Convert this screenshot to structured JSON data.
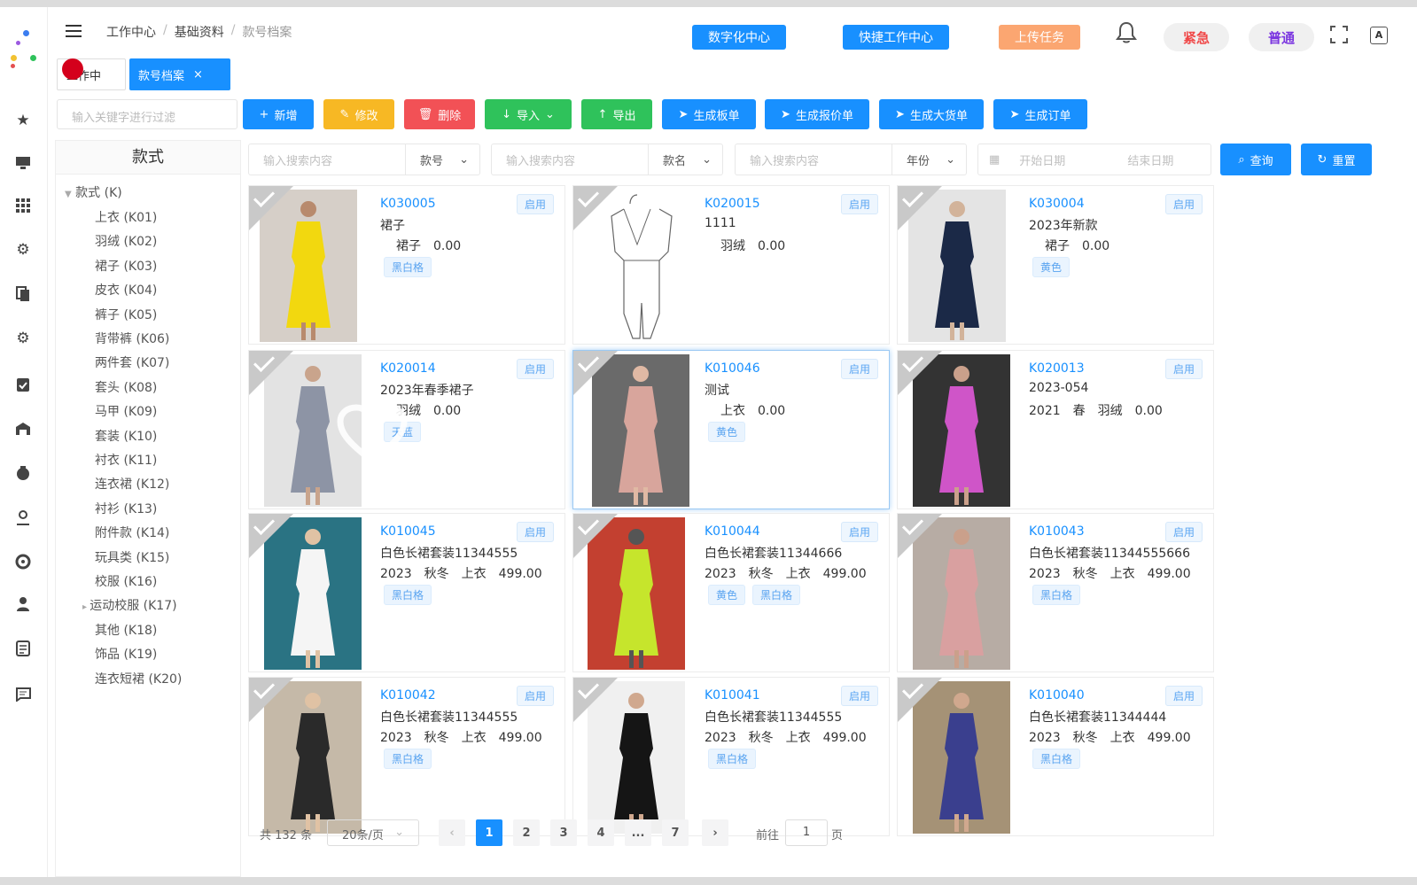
{
  "breadcrumb": [
    "工作中心",
    "基础资料",
    "款号档案"
  ],
  "topbar": {
    "btn_digital": "数字化中心",
    "btn_quick": "快捷工作中心",
    "btn_upload": "上传任务",
    "pill_urgent": "紧急",
    "pill_normal": "普通",
    "lang": "A"
  },
  "tabs": [
    {
      "label": "工作中"
    },
    {
      "label": "款号档案",
      "close": "×"
    }
  ],
  "toolbar": {
    "filter_placeholder": "输入关键字进行过滤",
    "actions": [
      "新增",
      "修改",
      "删除",
      "导入",
      "导出",
      "生成板单",
      "生成报价单",
      "生成大货单",
      "生成订单"
    ]
  },
  "colors": {
    "primary": "#1890ff",
    "warning": "#f7b824",
    "danger": "#f25156",
    "success": "#2fc25b",
    "upload": "#fba671"
  },
  "tree": {
    "header": "款式",
    "root": "款式 (K)",
    "items": [
      "上衣 (K01)",
      "羽绒 (K02)",
      "裙子 (K03)",
      "皮衣 (K04)",
      "裤子 (K05)",
      "背带裤 (K06)",
      "两件套 (K07)",
      "套头 (K08)",
      "马甲 (K09)",
      "套装 (K10)",
      "衬衣 (K11)",
      "连衣裙 (K12)",
      "衬衫 (K13)",
      "附件款 (K14)",
      "玩具类 (K15)",
      "校服 (K16)",
      "运动校服 (K17)",
      "其他 (K18)",
      "饰品 (K19)",
      "连衣短裙 (K20)"
    ]
  },
  "search": {
    "placeholder": "输入搜索内容",
    "sel_code": "款号",
    "sel_name": "款名",
    "sel_year": "年份",
    "start_date": "开始日期",
    "end_date": "结束日期",
    "btn_query": "查询",
    "btn_reset": "重置"
  },
  "cards": [
    {
      "code": "K030005",
      "status": "启用",
      "line1": "裙子",
      "line2": "裙子　0.00",
      "tags": [
        "黑白格"
      ]
    },
    {
      "code": "K020015",
      "status": "启用",
      "line1": "1111",
      "line2": "羽绒　0.00",
      "tags": []
    },
    {
      "code": "K030004",
      "status": "启用",
      "line1": "2023年新款",
      "line2": "裙子　0.00",
      "tags": [
        "黄色"
      ]
    },
    {
      "code": "K020014",
      "status": "启用",
      "line1": "2023年春季裙子",
      "line2": "羽绒　0.00",
      "tags": [
        "天蓝"
      ]
    },
    {
      "code": "K010046",
      "status": "启用",
      "line1": "测试",
      "line2": "上衣　0.00",
      "tags": [
        "黄色"
      ]
    },
    {
      "code": "K020013",
      "status": "启用",
      "line1": "2023-054",
      "line2": "2021　春　羽绒　0.00",
      "tags": []
    },
    {
      "code": "K010045",
      "status": "启用",
      "line1": "白色长裙套装11344555",
      "line2": "2023　秋冬　上衣　499.00",
      "tags": [
        "黑白格"
      ]
    },
    {
      "code": "K010044",
      "status": "启用",
      "line1": "白色长裙套装11344666",
      "line2": "2023　秋冬　上衣　499.00",
      "tags": [
        "黄色",
        "黑白格"
      ]
    },
    {
      "code": "K010043",
      "status": "启用",
      "line1": "白色长裙套装11344555666",
      "line2": "2023　秋冬　上衣　499.00",
      "tags": [
        "黑白格"
      ]
    },
    {
      "code": "K010042",
      "status": "启用",
      "line1": "白色长裙套装11344555",
      "line2": "2023　秋冬　上衣　499.00",
      "tags": [
        "黑白格"
      ]
    },
    {
      "code": "K010041",
      "status": "启用",
      "line1": "白色长裙套装11344555",
      "line2": "2023　秋冬　上衣　499.00",
      "tags": [
        "黑白格"
      ]
    },
    {
      "code": "K010040",
      "status": "启用",
      "line1": "白色长裙套装11344444",
      "line2": "2023　秋冬　上衣　499.00",
      "tags": [
        "黑白格"
      ]
    }
  ],
  "pager": {
    "total": "共 132 条",
    "size": "20条/页",
    "pages": [
      "1",
      "2",
      "3",
      "4",
      "...",
      "7"
    ],
    "current": "1",
    "goto": "前往",
    "goto_value": "1",
    "page_unit": "页"
  }
}
